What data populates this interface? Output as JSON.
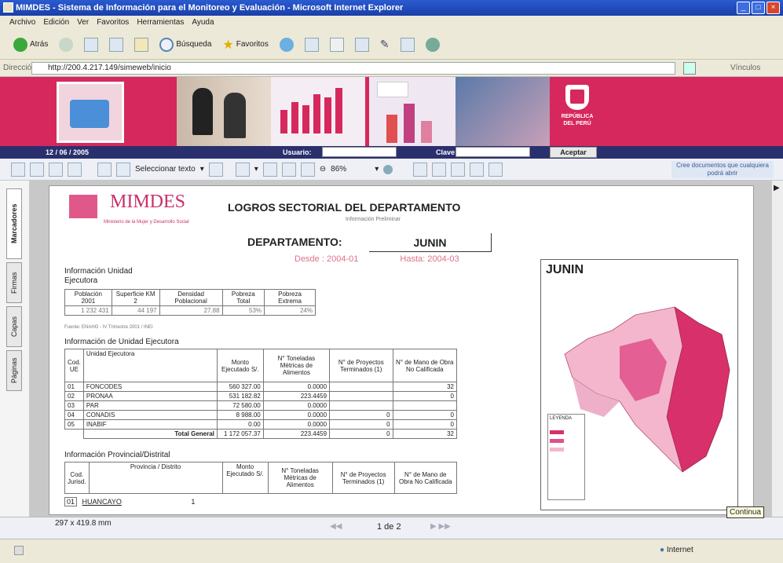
{
  "window": {
    "title": "MIMDES - Sistema de Información para el Monitoreo y Evaluación - Microsoft Internet Explorer"
  },
  "menu": [
    "Archivo",
    "Edición",
    "Ver",
    "Favoritos",
    "Herramientas",
    "Ayuda"
  ],
  "toolbar": {
    "back_label": "Atrás",
    "search_label": "Búsqueda",
    "favorites_label": "Favoritos"
  },
  "address": {
    "label": "Dirección",
    "url": "http://200.4.217.149/simeweb/inicio",
    "links_label": "Vínculos"
  },
  "site_bar": {
    "date": "12 / 06 / 2005",
    "user_label": "Usuario:",
    "password_label": "Clave:",
    "accept_label": "Aceptar"
  },
  "banner": {
    "republica_label": "REPÚBLICA DEL PERÚ"
  },
  "report_toolbar": {
    "select_text_label": "Seleccionar texto",
    "zoom": "86%",
    "promo": "Cree documentos que cualquiera podrá abrir"
  },
  "side_tabs": [
    "Marcadores",
    "Firmas",
    "Capas",
    "Páginas"
  ],
  "report": {
    "brand": "MIMDES",
    "brand_sub": "Ministerio de la Mujer y Desarrollo Social",
    "title": "LOGROS SECTORIAL  DEL DEPARTAMENTO",
    "subtitle": "Información Preliminar",
    "dept_label": "DEPARTAMENTO:",
    "dept_value": "JUNIN",
    "desde_label": "Desde :",
    "desde_value": "2004-01",
    "hasta_label": "Hasta:",
    "hasta_value": "2004-03",
    "unidad_title": "Información Unidad Ejecutora",
    "stats_headers": [
      "Población 2001",
      "Superficie KM 2",
      "Densidad Poblacional",
      "Pobreza Total",
      "Pobreza Extrema"
    ],
    "stats_values": [
      "1 232 431",
      "44 197",
      "27.88",
      "53%",
      "24%"
    ],
    "fuente": "Fuente: ENAHO - IV Trimestre 2001 / INEI",
    "unidad2_title": "Información  de Unidad Ejecutora",
    "ue_headers": [
      "Cod. UE",
      "Unidad Ejecutora",
      "Monto Ejecutado S/.",
      "N° Toneladas Métricas de Alimentos",
      "N° de Proyectos Terminados (1)",
      "N° de Mano de Obra No Calificada"
    ],
    "ue_rows": [
      [
        "01",
        "FONCODES",
        "560 327.00",
        "0.0000",
        "",
        "32"
      ],
      [
        "02",
        "PRONAA",
        "531 182.82",
        "223.4459",
        "",
        "0"
      ],
      [
        "03",
        "PAR",
        "72 580.00",
        "0.0000",
        "",
        ""
      ],
      [
        "04",
        "CONADIS",
        "8 988.00",
        "0.0000",
        "0",
        "0"
      ],
      [
        "05",
        "INABIF",
        "0.00",
        "0.0000",
        "0",
        "0"
      ]
    ],
    "total_label": "Total General",
    "total_values": [
      "1 172 057.37",
      "223.4459",
      "0",
      "32"
    ],
    "prov_title": "Información  Provincial/Distrital",
    "prov_headers": [
      "Cod. Jurisd.",
      "Provincia / Distrito",
      "Monto Ejecutado S/.",
      "N° Toneladas Métricas de Alimentos",
      "N° de Proyectos Terminados (1)",
      "N° de Mano de Obra No Calificada"
    ],
    "prov_row_code": "01",
    "prov_row_name": "HUANCAYO",
    "prov_row_value": "1",
    "map_title": "JUNIN",
    "legend_title": "LEYENDA"
  },
  "status": {
    "page_size": "297 x 419.8 mm",
    "page_indicator": "1 de 2",
    "continua": "Continua",
    "zone": "Internet"
  },
  "colors": {
    "banner": "#d6285c",
    "titlebar": "#1a3fa8",
    "navy": "#2a2f6e"
  }
}
